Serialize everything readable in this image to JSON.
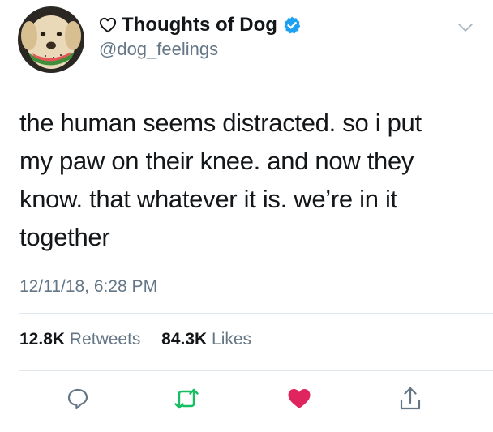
{
  "tweet": {
    "display_name": "Thoughts of Dog",
    "handle": "@dog_feelings",
    "text_lines": [
      "the human seems distracted. so i put",
      "my paw on their knee. and now they",
      "know. that whatever it is. we’re in it",
      "together"
    ],
    "timestamp": "12/11/18, 6:28 PM",
    "retweets_count": "12.8K",
    "retweets_label": "Retweets",
    "likes_count": "84.3K",
    "likes_label": "Likes",
    "liked": true
  },
  "icons": {
    "name_prefix": "heart-outline-icon",
    "verified": "verified-badge-icon",
    "menu": "chevron-down-icon",
    "reply": "reply-icon",
    "retweet": "retweet-icon",
    "like": "heart-icon",
    "share": "share-icon"
  },
  "colors": {
    "text": "#14171a",
    "secondary": "#657786",
    "verified_blue": "#1da1f2",
    "retweet_green": "#17bf63",
    "like_red": "#e0245e",
    "divider": "#e1e8ed"
  }
}
